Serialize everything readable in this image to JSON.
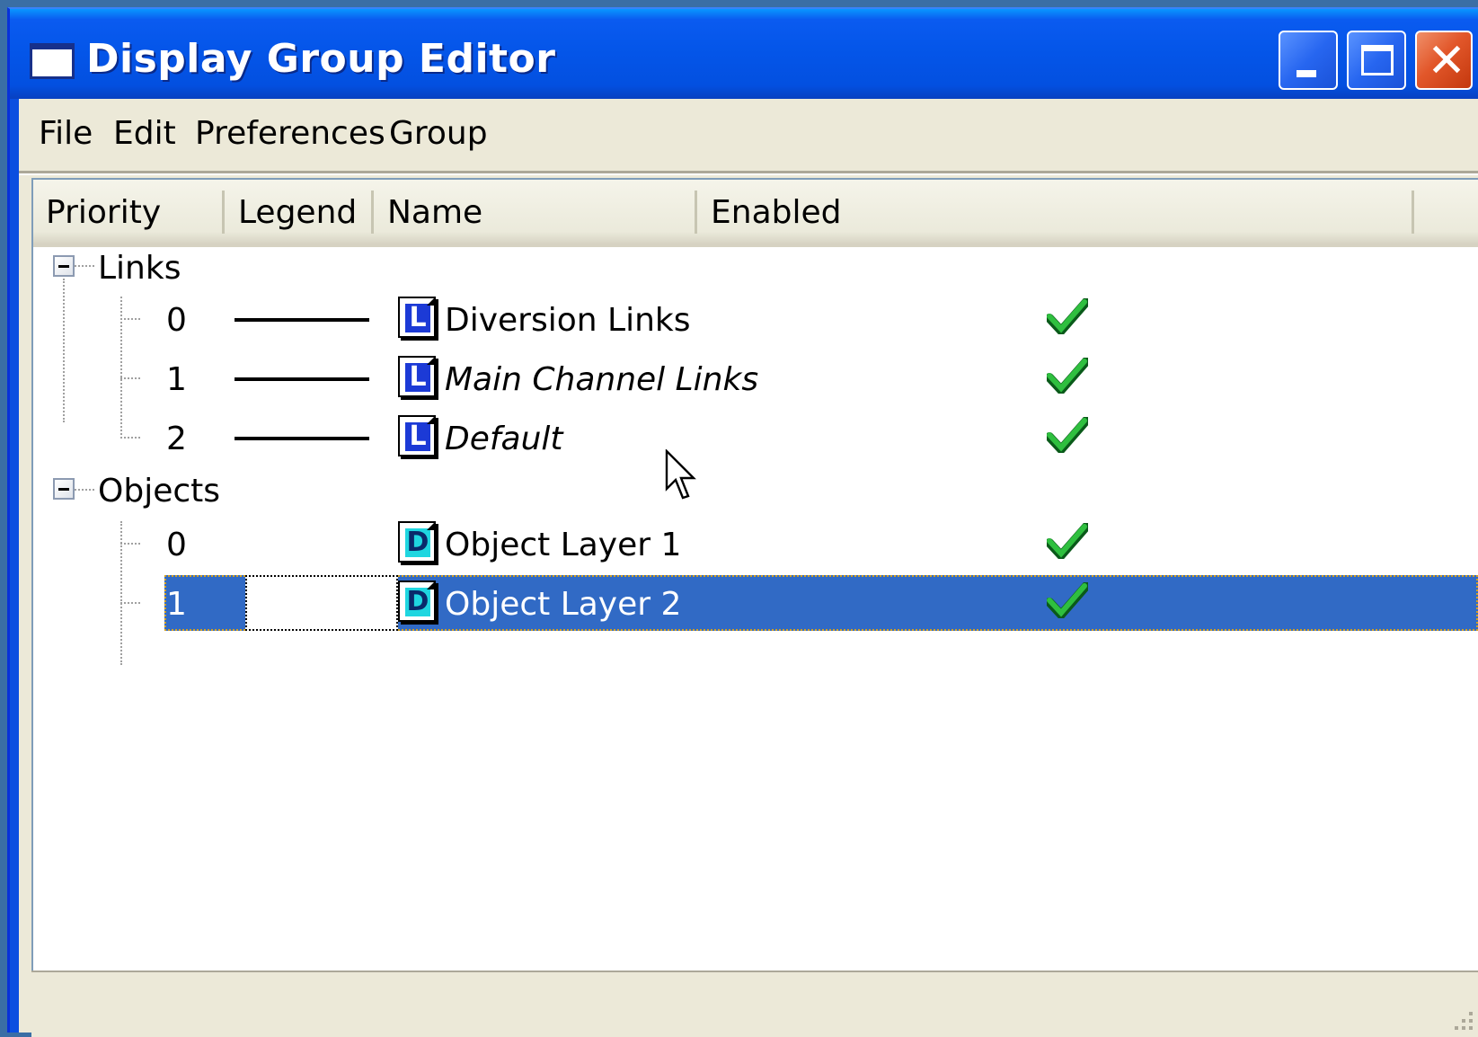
{
  "window": {
    "title": "Display Group Editor",
    "buttons": [
      "minimize",
      "maximize",
      "close"
    ]
  },
  "menu": {
    "items": [
      "File",
      "Edit",
      "Preferences",
      "Group"
    ]
  },
  "columns": [
    "Priority",
    "Legend",
    "Name",
    "Enabled"
  ],
  "groups": [
    {
      "label": "Links",
      "expanded": true,
      "layers": [
        {
          "priority": "0",
          "legend": "solid-line",
          "icon": "L",
          "name": "Diversion Links",
          "italic": false,
          "enabled": true
        },
        {
          "priority": "1",
          "legend": "solid-line",
          "icon": "L",
          "name": "Main Channel Links",
          "italic": true,
          "enabled": true
        },
        {
          "priority": "2",
          "legend": "solid-line",
          "icon": "L",
          "name": "Default",
          "italic": true,
          "enabled": true
        }
      ]
    },
    {
      "label": "Objects",
      "expanded": true,
      "layers": [
        {
          "priority": "0",
          "legend": "none",
          "icon": "D",
          "name": "Object Layer 1",
          "italic": false,
          "enabled": true
        },
        {
          "priority": "1",
          "legend": "none",
          "icon": "D",
          "name": "Object Layer 2",
          "italic": false,
          "enabled": true,
          "selected": true
        }
      ]
    }
  ],
  "colors": {
    "titlebar": "#0455e8",
    "selection": "#316ac5",
    "check": "#1a9a2a",
    "link_icon": "#1c3ad6",
    "object_icon": "#1fd6e0"
  },
  "icons": {
    "layer_link": "L",
    "layer_object": "D"
  }
}
